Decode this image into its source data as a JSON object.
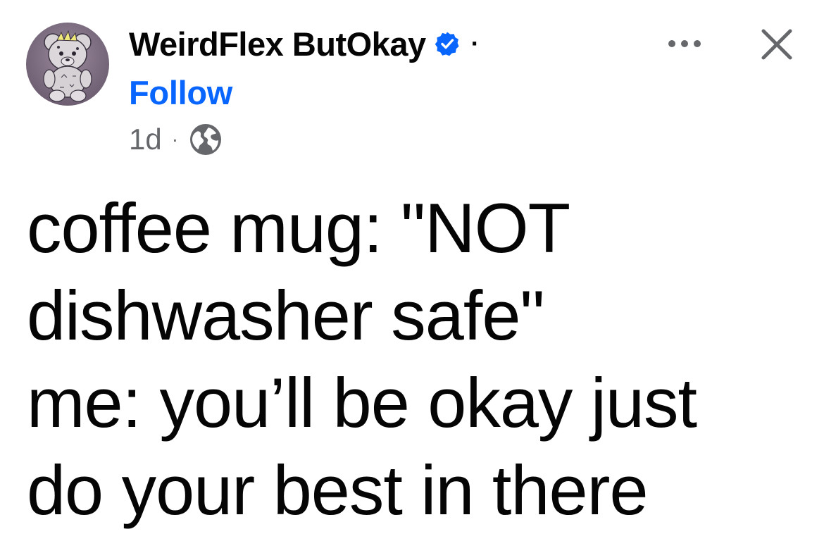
{
  "post": {
    "author": {
      "name": "WeirdFlex ButOkay",
      "verified": true,
      "avatar": "teddy-bear-avatar"
    },
    "header_separator": "·",
    "follow_label": "Follow",
    "meta": {
      "time": "1d",
      "separator": "·",
      "audience_icon": "globe-icon"
    },
    "actions": {
      "more_icon": "more-icon",
      "close_icon": "close-icon"
    },
    "body_lines": [
      "coffee mug: \"NOT",
      "dishwasher safe\"",
      "me: you’ll be okay just",
      "do your best in there"
    ],
    "colors": {
      "text": "#050505",
      "secondary_text": "#65676b",
      "link": "#0866ff",
      "verified_badge": "#0866ff"
    }
  }
}
